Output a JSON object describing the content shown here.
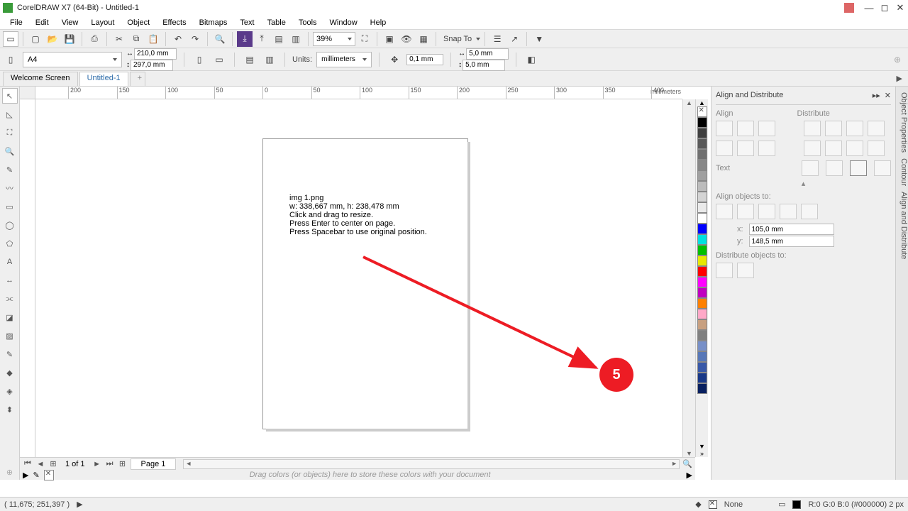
{
  "titlebar": {
    "title": "CorelDRAW X7 (64-Bit) - Untitled-1"
  },
  "menu": [
    "File",
    "Edit",
    "View",
    "Layout",
    "Object",
    "Effects",
    "Bitmaps",
    "Text",
    "Table",
    "Tools",
    "Window",
    "Help"
  ],
  "toolbar": {
    "zoom": "39%",
    "snap": "Snap To"
  },
  "property": {
    "pageSize": "A4",
    "width": "210,0 mm",
    "height": "297,0 mm",
    "unitsLabel": "Units:",
    "units": "millimeters",
    "nudge": "0,1 mm",
    "dupX": "5,0 mm",
    "dupY": "5,0 mm"
  },
  "tabs": {
    "welcome": "Welcome Screen",
    "doc": "Untitled-1"
  },
  "ruler": {
    "unitsLabel": "millimeters",
    "ticks": [
      -200,
      -150,
      -100,
      -50,
      0,
      50,
      100,
      150,
      200,
      250,
      300,
      350,
      400
    ]
  },
  "canvasText": {
    "l1": "img 1.png",
    "l2": "w: 338,667 mm, h: 238,478 mm",
    "l3": "Click and drag to resize.",
    "l4": "Press Enter to center on page.",
    "l5": "Press Spacebar to use original position."
  },
  "annotation": {
    "badge": "5"
  },
  "paging": {
    "indicator": "1 of 1",
    "pageTab": "Page 1"
  },
  "trayHint": "Drag colors (or objects) here to store these colors with your document",
  "palette": [
    "#000000",
    "#3f3f3f",
    "#5a5a5a",
    "#707070",
    "#888888",
    "#a0a0a0",
    "#bcbcbc",
    "#d4d4d4",
    "#eaeaea",
    "#ffffff",
    "#0000ff",
    "#00e0e0",
    "#00c000",
    "#e8e800",
    "#ff0000",
    "#ff00ff",
    "#c000c0",
    "#ff8000",
    "#ffa8c8",
    "#c8a080",
    "#808080",
    "#7890c8",
    "#5878b8",
    "#3858a8",
    "#183888",
    "#082060"
  ],
  "docker": {
    "title": "Align and Distribute",
    "alignLabel": "Align",
    "distLabel": "Distribute",
    "textLabel": "Text",
    "alignObjLabel": "Align objects to:",
    "x": "105,0 mm",
    "y": "148,5 mm",
    "distObjLabel": "Distribute objects to:",
    "sideTabs": [
      "Object Properties",
      "Contour",
      "Align and Distribute"
    ]
  },
  "status": {
    "coords": "( 11,675; 251,397 )",
    "fillNone": "None",
    "outline": "R:0 G:0 B:0 (#000000) 2 px"
  }
}
